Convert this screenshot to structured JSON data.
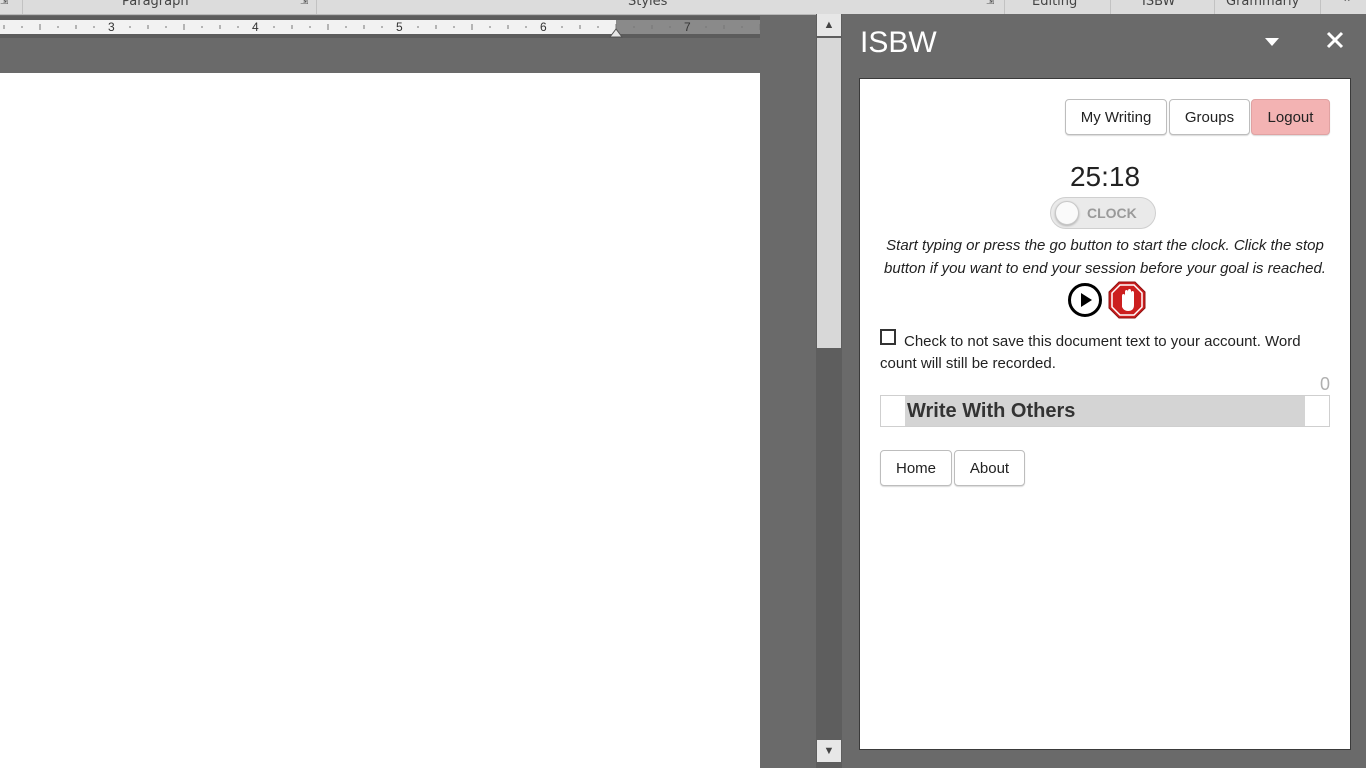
{
  "ribbon": {
    "groups": [
      "Paragraph",
      "Styles",
      "Editing",
      "ISBW",
      "Grammarly"
    ]
  },
  "ruler": {
    "numbers": [
      "3",
      "4",
      "5",
      "6",
      "7"
    ]
  },
  "pane": {
    "title": "ISBW"
  },
  "addin": {
    "nav": {
      "my_writing": "My Writing",
      "groups": "Groups",
      "logout": "Logout"
    },
    "timer": "25:18",
    "clock_toggle": {
      "label": "CLOCK",
      "on": false
    },
    "instructions": "Start typing or press the go button to start the clock. Click the stop button if you want to end your session before your goal is reached.",
    "no_save": {
      "checked": false,
      "label": "Check to not save this document text to your account. Word count will still be recorded."
    },
    "word_count": "0",
    "write_with_others": "Write With Others",
    "footer": {
      "home": "Home",
      "about": "About"
    }
  },
  "colors": {
    "logout_bg": "#f3b3b3",
    "stop_red": "#cc1f1f",
    "pane_bg": "#6a6a6a"
  },
  "icons": {
    "dropdown": "chevron-down-icon",
    "close": "close-icon",
    "go": "play-icon",
    "stop": "stop-hand-icon"
  }
}
